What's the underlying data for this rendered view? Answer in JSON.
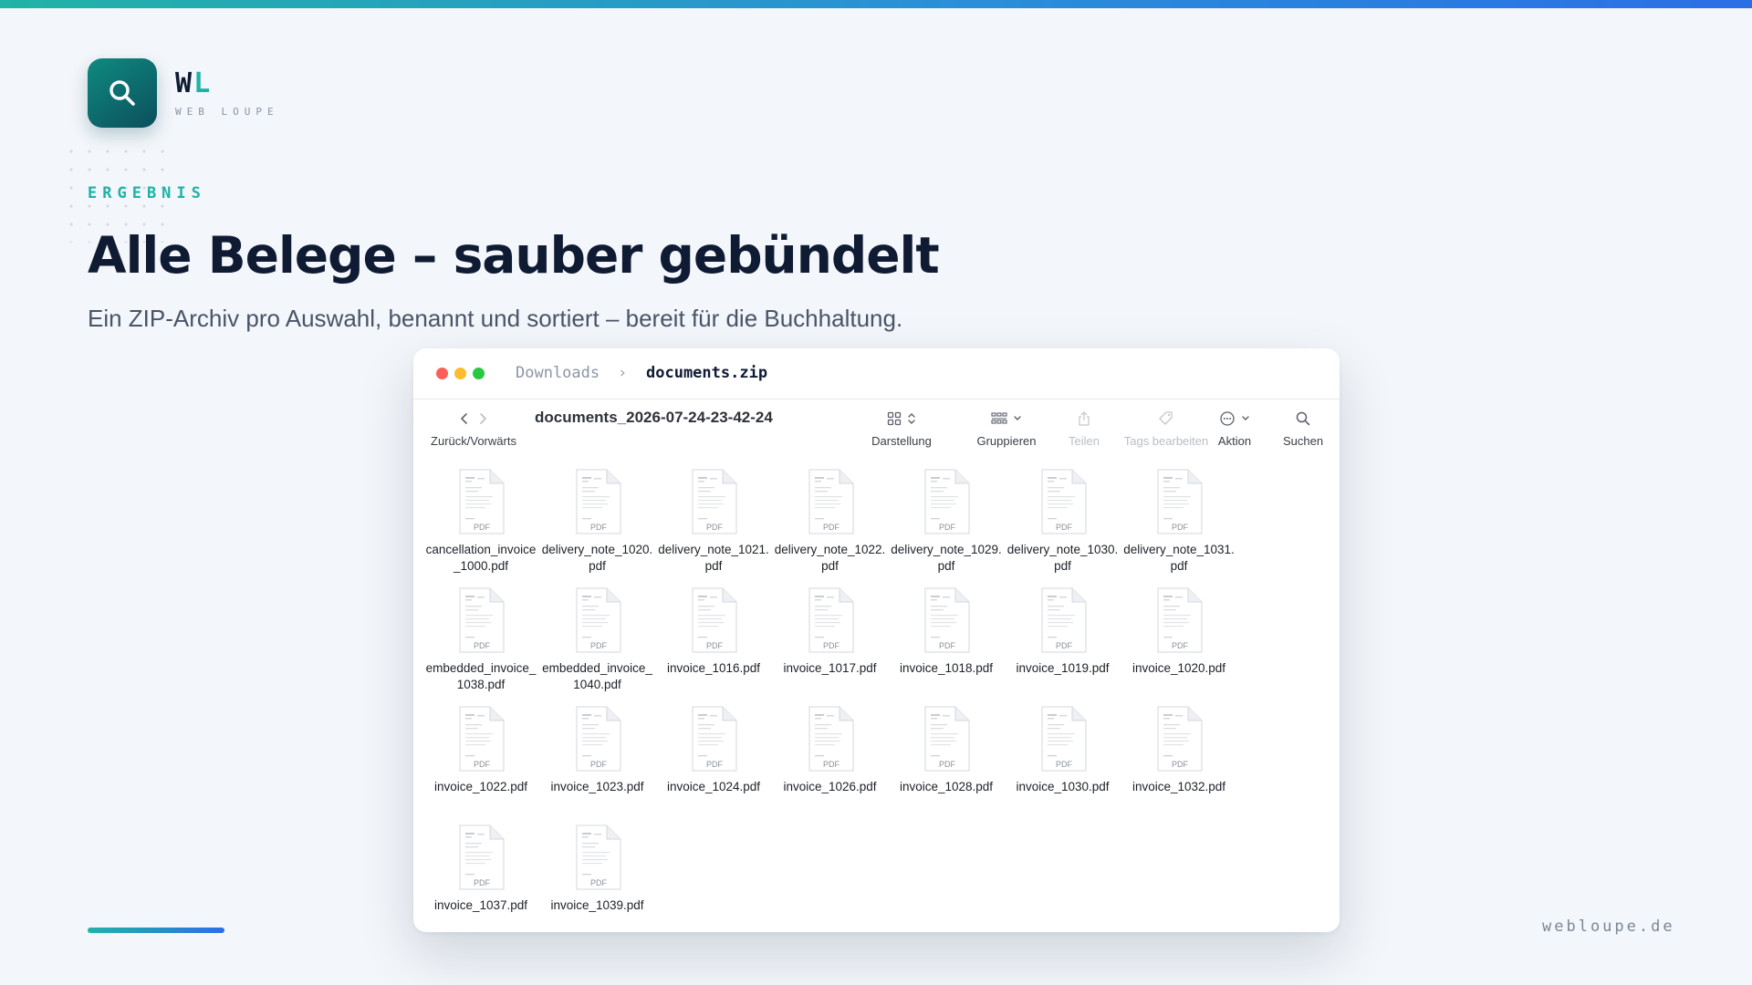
{
  "brand": {
    "logo_letters_main": "W",
    "logo_letters_accent": "L",
    "logo_subtitle": "WEB LOUPE",
    "accent_color": "#1fb2a5",
    "tile_icon": "search-icon"
  },
  "slide": {
    "eyebrow": "ERGEBNIS",
    "headline": "Alle Belege – sauber gebündelt",
    "subline": "Ein ZIP-Archiv pro Auswahl, benannt und sortiert – bereit für die Buchhaltung.",
    "footer_site": "webloupe.de"
  },
  "finder": {
    "breadcrumb": [
      "Downloads",
      "documents.zip"
    ],
    "breadcrumb_separator": "›",
    "folder_title": "documents_2026-07-24-23-42-24",
    "toolbar": {
      "nav_label": "Zurück/Vorwärts",
      "view_label": "Darstellung",
      "group_label": "Gruppieren",
      "share_label": "Teilen",
      "tags_label": "Tags bearbeiten",
      "action_label": "Aktion",
      "search_label": "Suchen"
    },
    "file_badge": "PDF",
    "files": [
      "cancellation_invoice_1000.pdf",
      "delivery_note_1020.pdf",
      "delivery_note_1021.pdf",
      "delivery_note_1022.pdf",
      "delivery_note_1029.pdf",
      "delivery_note_1030.pdf",
      "delivery_note_1031.pdf",
      "embedded_invoice_1038.pdf",
      "embedded_invoice_1040.pdf",
      "invoice_1016.pdf",
      "invoice_1017.pdf",
      "invoice_1018.pdf",
      "invoice_1019.pdf",
      "invoice_1020.pdf",
      "invoice_1022.pdf",
      "invoice_1023.pdf",
      "invoice_1024.pdf",
      "invoice_1026.pdf",
      "invoice_1028.pdf",
      "invoice_1030.pdf",
      "invoice_1032.pdf",
      "invoice_1037.pdf",
      "invoice_1039.pdf"
    ]
  }
}
